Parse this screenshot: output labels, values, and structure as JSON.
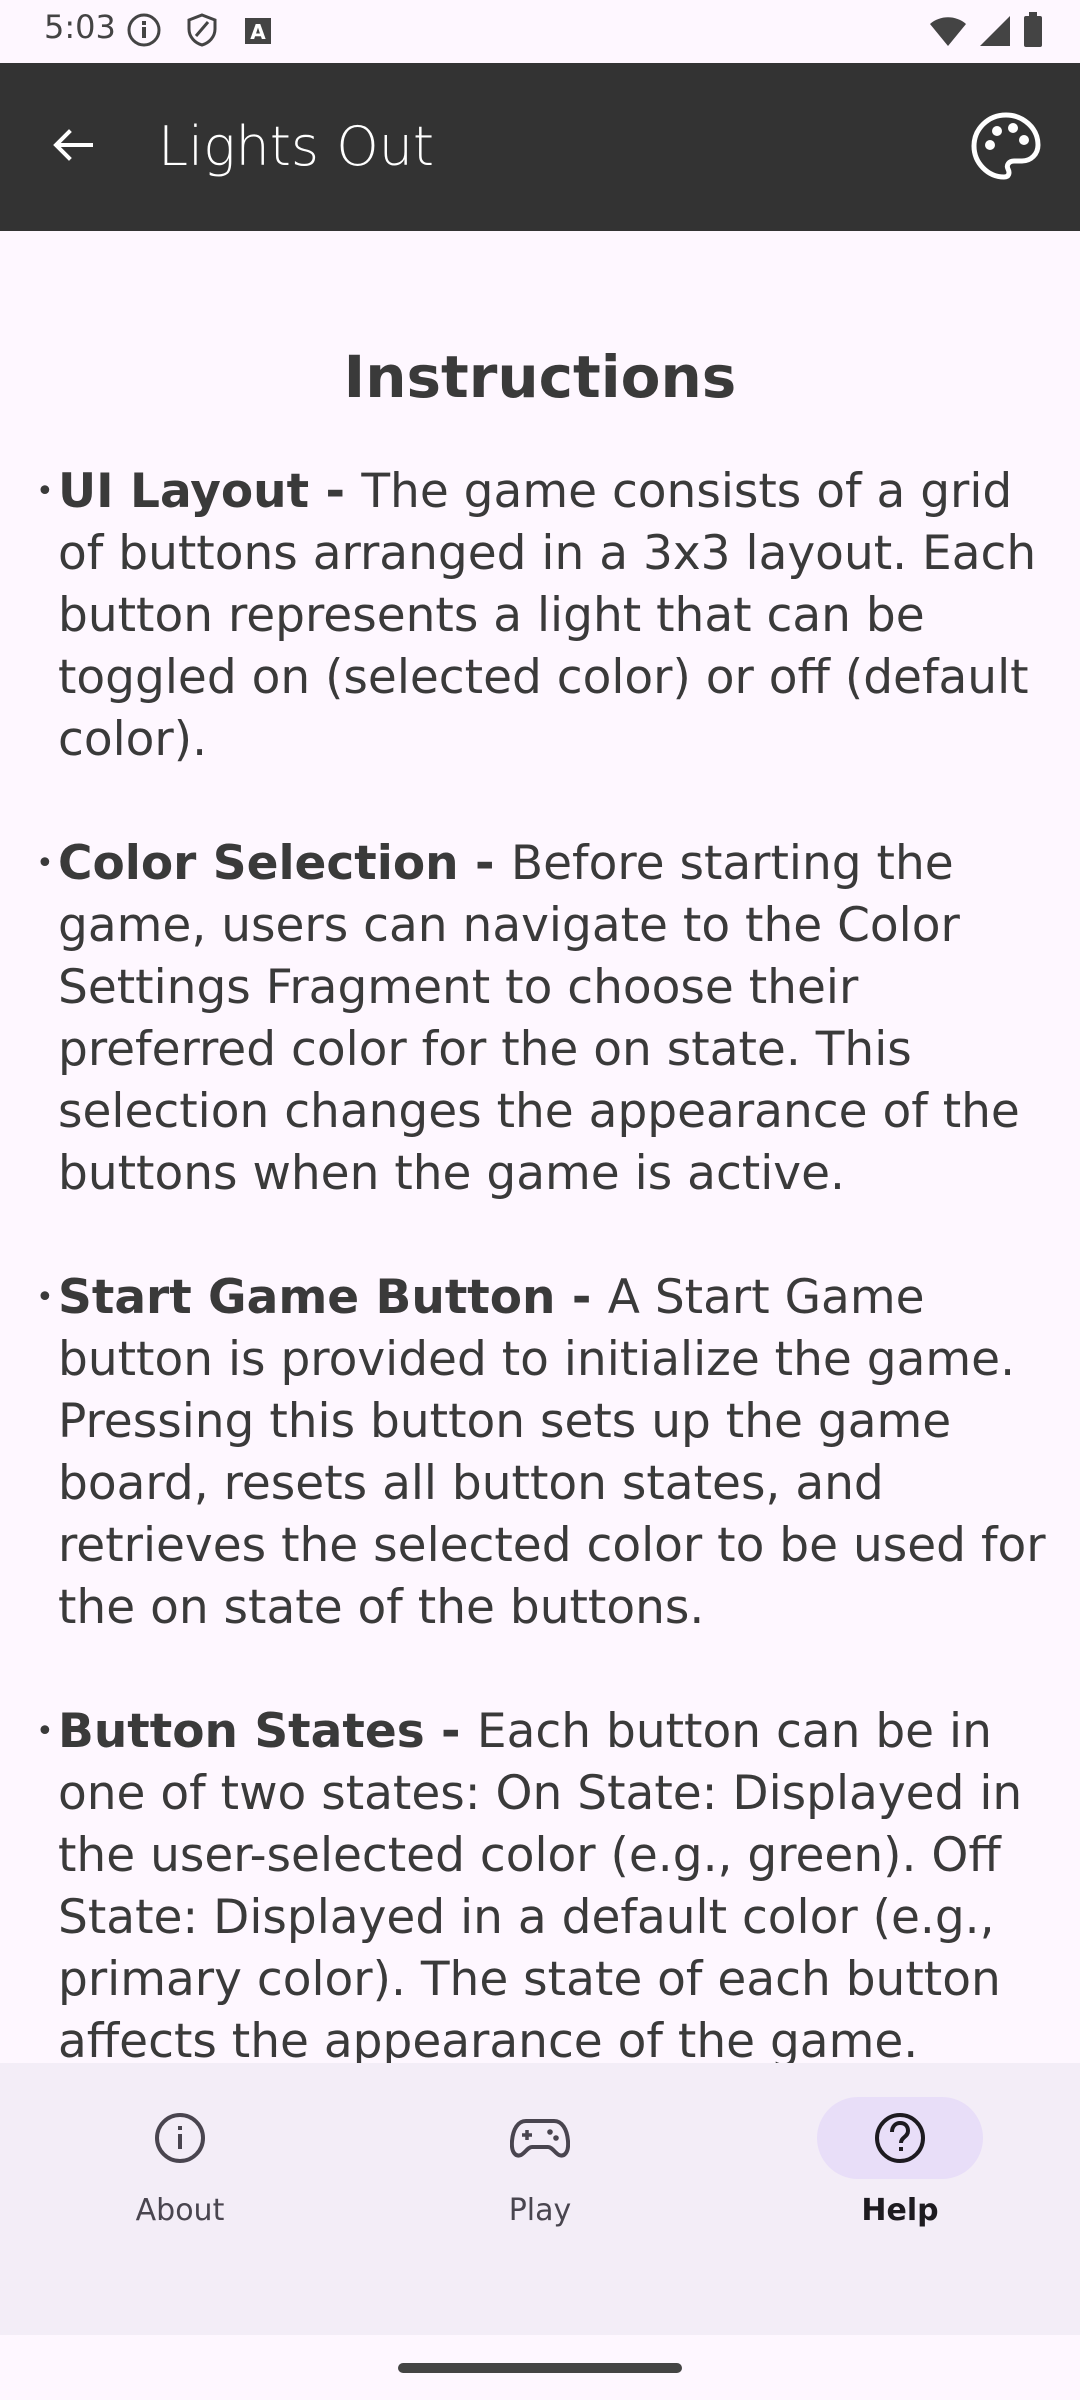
{
  "status_bar": {
    "time": "5:03",
    "left_icons": [
      "info-icon",
      "shield-icon",
      "font-a-icon"
    ],
    "right_icons": [
      "wifi-icon",
      "signal-icon",
      "battery-icon"
    ]
  },
  "app_bar": {
    "title": "Lights Out",
    "back_icon": "arrow-back-icon",
    "action_icon": "palette-icon",
    "background": "#333333"
  },
  "content": {
    "heading": "Instructions",
    "items": [
      {
        "label": "UI Layout - ",
        "text": " The game consists of a grid of buttons arranged in a 3x3 layout. Each button represents a light that can be toggled on (selected color) or off (default color)."
      },
      {
        "label": "Color Selection - ",
        "text": "Before starting the game, users can navigate to the Color Settings Fragment to choose their preferred color for the on state. This selection changes the appearance of the buttons when the game is active."
      },
      {
        "label": "Start Game Button - ",
        "text": "A Start Game button is provided to initialize the game. Pressing this button sets up the game board, resets all button states, and retrieves the selected color to be used for the on state of the buttons."
      },
      {
        "label": "Button States - ",
        "text": "Each button can be in one of two states: On State: Displayed in the user-selected color (e.g., green). Off State: Displayed in a default color (e.g., primary color). The state of each button affects the appearance of the game."
      }
    ]
  },
  "bottom_nav": {
    "items": [
      {
        "label": "About",
        "icon": "info-icon",
        "active": false
      },
      {
        "label": "Play",
        "icon": "gamepad-icon",
        "active": false
      },
      {
        "label": "Help",
        "icon": "help-icon",
        "active": true
      }
    ],
    "active_indicator_color": "#e8def8"
  }
}
